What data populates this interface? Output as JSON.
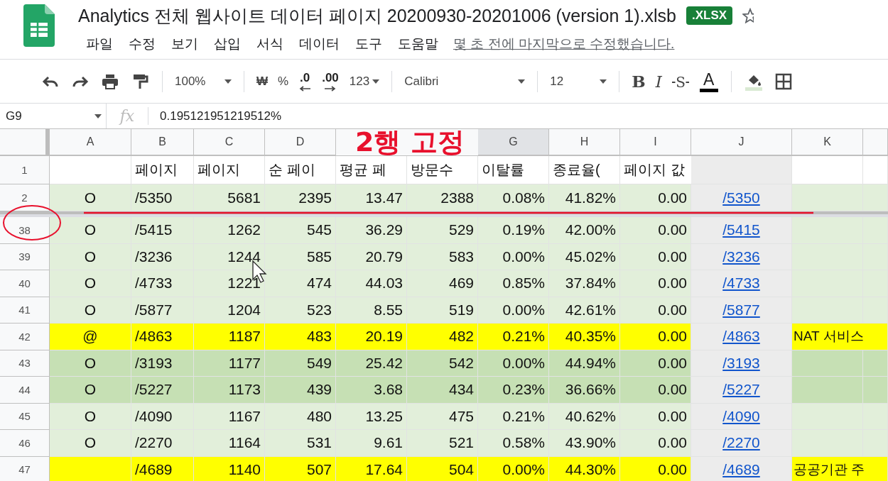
{
  "document": {
    "title": "Analytics 전체 웹사이트 데이터 페이지 20200930-20201006 (version 1).xlsb",
    "format_badge": ".XLSX"
  },
  "menu": [
    "파일",
    "수정",
    "보기",
    "삽입",
    "서식",
    "데이터",
    "도구",
    "도움말"
  ],
  "last_edit": "몇 초 전에 마지막으로 수정했습니다.",
  "toolbar": {
    "zoom": "100%",
    "currency": "₩",
    "percent": "%",
    "decrease_decimal": ".0",
    "increase_decimal": ".00",
    "number_format": "123",
    "font": "Calibri",
    "font_size": "12",
    "bold": "B",
    "italic": "I",
    "strikethrough": "S",
    "text_color": "A"
  },
  "formula_bar": {
    "cell": "G9",
    "fx": "fx",
    "value": "0.195121951219512%"
  },
  "columns": [
    {
      "label": "A",
      "selected": false
    },
    {
      "label": "B",
      "selected": false
    },
    {
      "label": "C",
      "selected": false
    },
    {
      "label": "D",
      "selected": false
    },
    {
      "selected": false
    },
    {
      "selected": false
    },
    {
      "label": "G",
      "selected": true
    },
    {
      "label": "H",
      "selected": false
    },
    {
      "label": "I",
      "selected": false
    },
    {
      "label": "J",
      "selected": false
    },
    {
      "label": "K",
      "selected": false
    },
    {
      "selected": false
    }
  ],
  "rows": [
    {
      "number": "1",
      "frozen": true,
      "kind": "header",
      "color": "#ffffff",
      "cells": {
        "B": "페이지",
        "C": "페이지",
        "D": "순 페이",
        "E": "평균 페",
        "F": "방문수",
        "G": "이탈률",
        "H": "종료율(",
        "I": "페이지 값"
      }
    },
    {
      "number": "2",
      "frozen": true,
      "kind": "data",
      "color": "#e2efda",
      "cells": {
        "A": "O",
        "B": "/5350",
        "C": "5681",
        "D": "2395",
        "E": "13.47",
        "F": "2388",
        "G": "0.08%",
        "H": "41.82%",
        "I": "0.00",
        "J": "/5350"
      }
    },
    {
      "number": "38",
      "frozen": false,
      "kind": "data",
      "color": "#e2efda",
      "cells": {
        "A": "O",
        "B": "/5415",
        "C": "1262",
        "D": "545",
        "E": "36.29",
        "F": "529",
        "G": "0.19%",
        "H": "42.00%",
        "I": "0.00",
        "J": "/5415"
      }
    },
    {
      "number": "39",
      "frozen": false,
      "kind": "data",
      "color": "#e2efda",
      "cells": {
        "A": "O",
        "B": "/3236",
        "C": "1244",
        "D": "585",
        "E": "20.79",
        "F": "583",
        "G": "0.00%",
        "H": "45.02%",
        "I": "0.00",
        "J": "/3236"
      }
    },
    {
      "number": "40",
      "frozen": false,
      "kind": "data",
      "color": "#e2efda",
      "cells": {
        "A": "O",
        "B": "/4733",
        "C": "1221",
        "D": "474",
        "E": "44.03",
        "F": "469",
        "G": "0.85%",
        "H": "37.84%",
        "I": "0.00",
        "J": "/4733"
      }
    },
    {
      "number": "41",
      "frozen": false,
      "kind": "data",
      "color": "#e2efda",
      "cells": {
        "A": "O",
        "B": "/5877",
        "C": "1204",
        "D": "523",
        "E": "8.55",
        "F": "519",
        "G": "0.00%",
        "H": "42.61%",
        "I": "0.00",
        "J": "/5877"
      }
    },
    {
      "number": "42",
      "frozen": false,
      "kind": "data",
      "color": "#ffff00",
      "cells": {
        "A": "@",
        "B": "/4863",
        "C": "1187",
        "D": "483",
        "E": "20.19",
        "F": "482",
        "G": "0.21%",
        "H": "40.35%",
        "I": "0.00",
        "J": "/4863",
        "K": "NAT 서비스"
      }
    },
    {
      "number": "43",
      "frozen": false,
      "kind": "data",
      "color": "#c6e0b4",
      "cells": {
        "A": "O",
        "B": "/3193",
        "C": "1177",
        "D": "549",
        "E": "25.42",
        "F": "542",
        "G": "0.00%",
        "H": "44.94%",
        "I": "0.00",
        "J": "/3193"
      }
    },
    {
      "number": "44",
      "frozen": false,
      "kind": "data",
      "color": "#c6e0b4",
      "cells": {
        "A": "O",
        "B": "/5227",
        "C": "1173",
        "D": "439",
        "E": "3.68",
        "F": "434",
        "G": "0.23%",
        "H": "36.66%",
        "I": "0.00",
        "J": "/5227"
      }
    },
    {
      "number": "45",
      "frozen": false,
      "kind": "data",
      "color": "#e2efda",
      "cells": {
        "A": "O",
        "B": "/4090",
        "C": "1167",
        "D": "480",
        "E": "13.25",
        "F": "475",
        "G": "0.21%",
        "H": "40.62%",
        "I": "0.00",
        "J": "/4090"
      }
    },
    {
      "number": "46",
      "frozen": false,
      "kind": "data",
      "color": "#e2efda",
      "cells": {
        "A": "O",
        "B": "/2270",
        "C": "1164",
        "D": "531",
        "E": "9.61",
        "F": "521",
        "G": "0.58%",
        "H": "43.90%",
        "I": "0.00",
        "J": "/2270"
      }
    },
    {
      "number": "47",
      "frozen": false,
      "kind": "data",
      "color": "#ffff00",
      "cells": {
        "B": "/4689",
        "C": "1140",
        "D": "507",
        "E": "17.64",
        "F": "504",
        "G": "0.00%",
        "H": "44.30%",
        "I": "0.00",
        "J": "/4689",
        "K": "공공기관 주"
      }
    }
  ],
  "annotation": {
    "label": "2행 고정"
  }
}
